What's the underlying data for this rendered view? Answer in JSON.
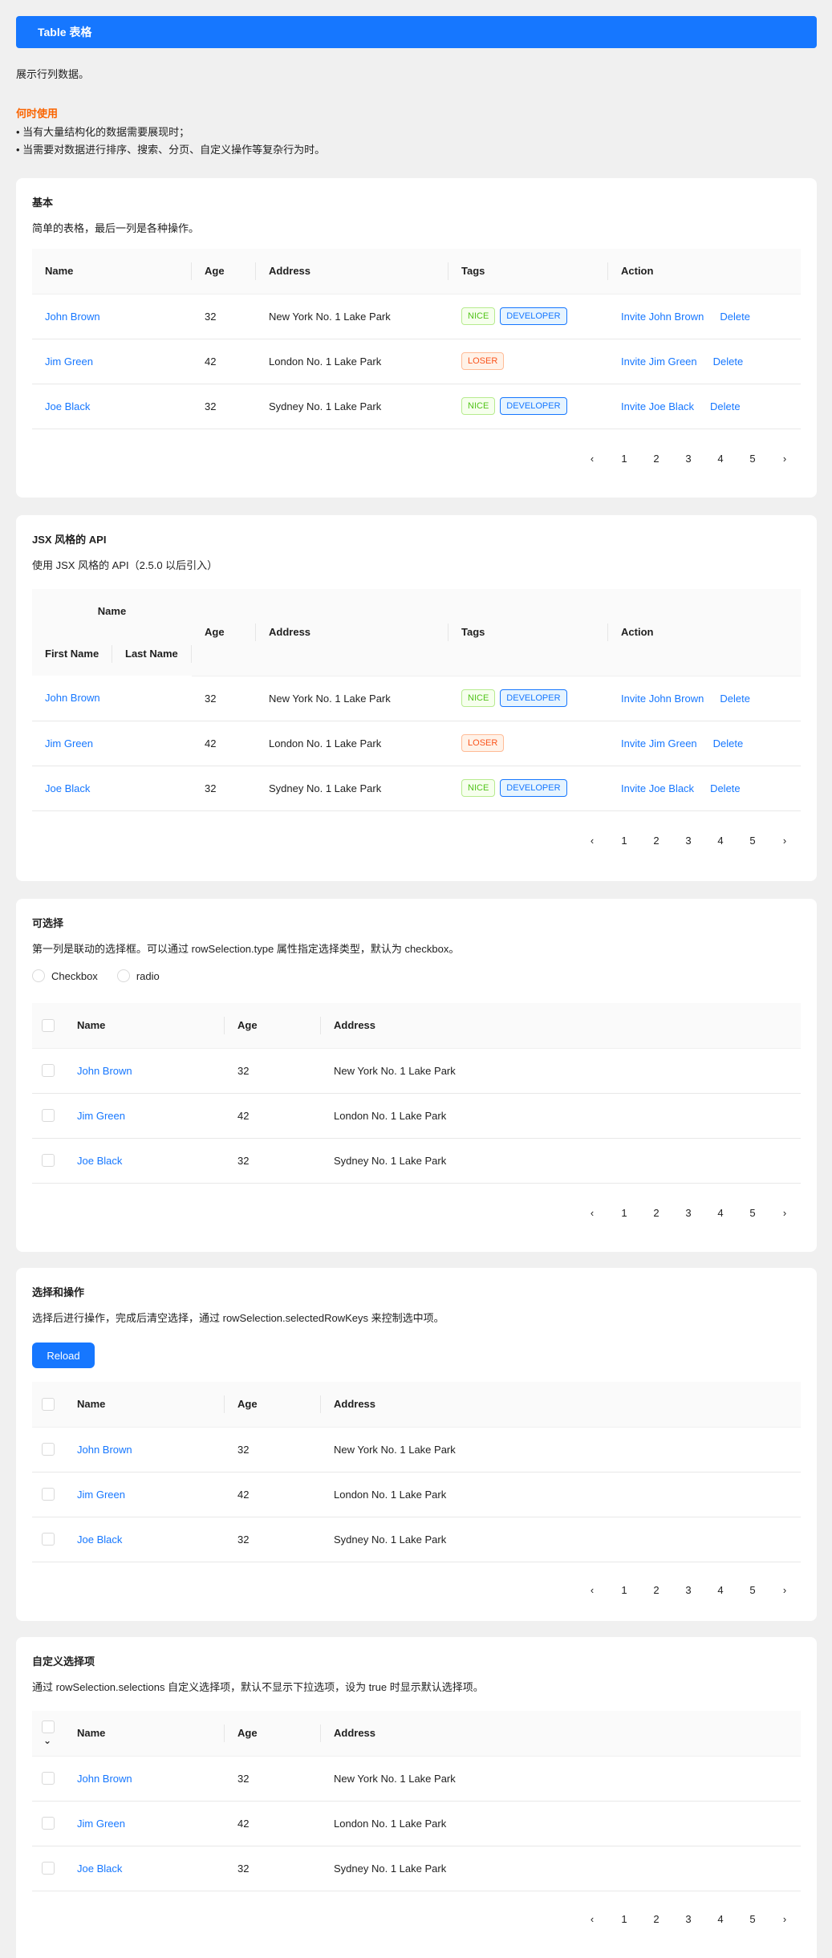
{
  "header": {
    "title": "Table 表格"
  },
  "intro": {
    "desc": "展示行列数据。",
    "when_title": "何时使用",
    "bullets": [
      "• 当有大量结构化的数据需要展现时；",
      "• 当需要对数据进行排序、搜索、分页、自定义操作等复杂行为时。"
    ]
  },
  "colors": {
    "primary": "#1677ff",
    "warning": "#fa6400",
    "bg": "#f0f0f0"
  },
  "columns": {
    "name": "Name",
    "age": "Age",
    "address": "Address",
    "tags": "Tags",
    "action": "Action",
    "first_name": "First Name",
    "last_name": "Last Name"
  },
  "rows": [
    {
      "name": "John Brown",
      "age": "32",
      "address": "New York No. 1 Lake Park",
      "tags": [
        "NICE",
        "DEVELOPER"
      ],
      "invite": "Invite John Brown",
      "delete": "Delete"
    },
    {
      "name": "Jim Green",
      "age": "42",
      "address": "London No. 1 Lake Park",
      "tags": [
        "LOSER"
      ],
      "invite": "Invite Jim Green",
      "delete": "Delete"
    },
    {
      "name": "Joe Black",
      "age": "32",
      "address": "Sydney No. 1 Lake Park",
      "tags": [
        "NICE",
        "DEVELOPER"
      ],
      "invite": "Invite Joe Black",
      "delete": "Delete"
    }
  ],
  "pagination": {
    "prev": "‹",
    "pages": [
      "1",
      "2",
      "3",
      "4",
      "5"
    ],
    "next": "›"
  },
  "sections": {
    "basic": {
      "title": "基本",
      "desc": "简单的表格，最后一列是各种操作。"
    },
    "jsx": {
      "title": "JSX 风格的 API",
      "desc": "使用 JSX 风格的 API（2.5.0 以后引入）"
    },
    "selectable": {
      "title": "可选择",
      "desc": "第一列是联动的选择框。可以通过 rowSelection.type 属性指定选择类型，默认为 checkbox。",
      "radio_options": [
        "Checkbox",
        "radio"
      ]
    },
    "select_ops": {
      "title": "选择和操作",
      "desc": "选择后进行操作，完成后清空选择，通过 rowSelection.selectedRowKeys 来控制选中项。",
      "reload_label": "Reload"
    },
    "custom": {
      "title": "自定义选择项",
      "desc": "通过 rowSelection.selections 自定义选择项，默认不显示下拉选项，设为 true 时显示默认选择项。"
    }
  }
}
